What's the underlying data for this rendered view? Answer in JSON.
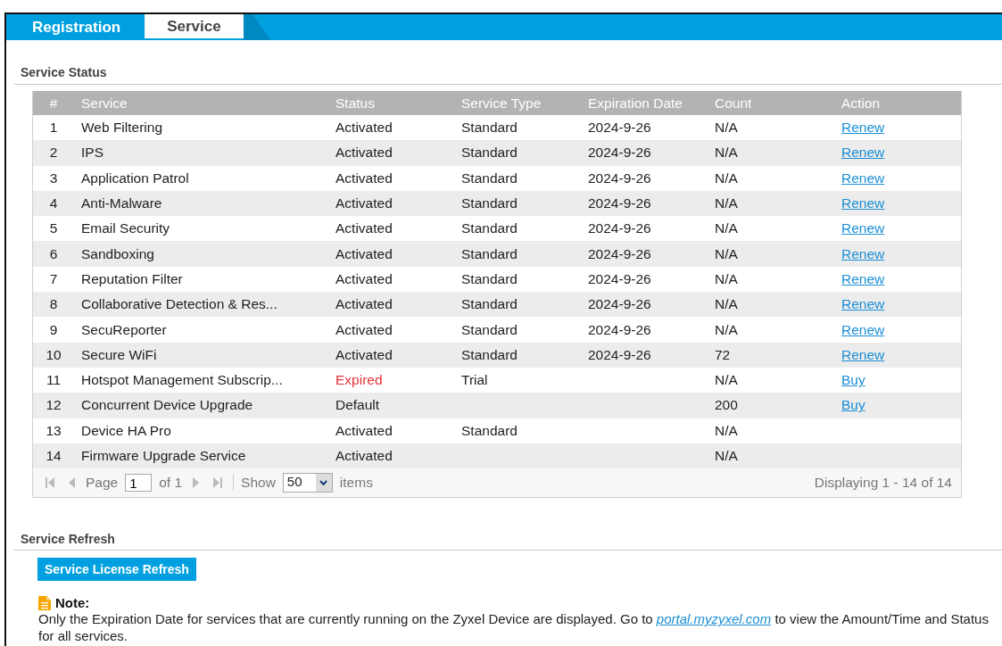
{
  "tabs": [
    {
      "label": "Registration",
      "selected": false
    },
    {
      "label": "Service",
      "selected": true
    }
  ],
  "service_status": {
    "title": "Service Status",
    "table": {
      "columns": [
        "#",
        "Service",
        "Status",
        "Service Type",
        "Expiration Date",
        "Count",
        "Action"
      ],
      "rows": [
        {
          "index": "1",
          "service": "Web Filtering",
          "status": "Activated",
          "expired": false,
          "type": "Standard",
          "expiration": "2024-9-26",
          "count": "N/A",
          "action": "Renew"
        },
        {
          "index": "2",
          "service": "IPS",
          "status": "Activated",
          "expired": false,
          "type": "Standard",
          "expiration": "2024-9-26",
          "count": "N/A",
          "action": "Renew"
        },
        {
          "index": "3",
          "service": "Application Patrol",
          "status": "Activated",
          "expired": false,
          "type": "Standard",
          "expiration": "2024-9-26",
          "count": "N/A",
          "action": "Renew"
        },
        {
          "index": "4",
          "service": "Anti-Malware",
          "status": "Activated",
          "expired": false,
          "type": "Standard",
          "expiration": "2024-9-26",
          "count": "N/A",
          "action": "Renew"
        },
        {
          "index": "5",
          "service": "Email Security",
          "status": "Activated",
          "expired": false,
          "type": "Standard",
          "expiration": "2024-9-26",
          "count": "N/A",
          "action": "Renew"
        },
        {
          "index": "6",
          "service": "Sandboxing",
          "status": "Activated",
          "expired": false,
          "type": "Standard",
          "expiration": "2024-9-26",
          "count": "N/A",
          "action": "Renew"
        },
        {
          "index": "7",
          "service": "Reputation Filter",
          "status": "Activated",
          "expired": false,
          "type": "Standard",
          "expiration": "2024-9-26",
          "count": "N/A",
          "action": "Renew"
        },
        {
          "index": "8",
          "service": "Collaborative Detection & Res...",
          "status": "Activated",
          "expired": false,
          "type": "Standard",
          "expiration": "2024-9-26",
          "count": "N/A",
          "action": "Renew"
        },
        {
          "index": "9",
          "service": "SecuReporter",
          "status": "Activated",
          "expired": false,
          "type": "Standard",
          "expiration": "2024-9-26",
          "count": "N/A",
          "action": "Renew"
        },
        {
          "index": "10",
          "service": "Secure WiFi",
          "status": "Activated",
          "expired": false,
          "type": "Standard",
          "expiration": "2024-9-26",
          "count": "72",
          "action": "Renew"
        },
        {
          "index": "11",
          "service": "Hotspot Management Subscrip...",
          "status": "Expired",
          "expired": true,
          "type": "Trial",
          "count": "N/A",
          "action": "Buy"
        },
        {
          "index": "12",
          "service": "Concurrent Device Upgrade",
          "status": "Default",
          "expired": false,
          "count": "200",
          "action": "Buy"
        },
        {
          "index": "13",
          "service": "Device HA Pro",
          "status": "Activated",
          "expired": false,
          "type": "Standard",
          "count": "N/A"
        },
        {
          "index": "14",
          "service": "Firmware Upgrade Service",
          "status": "Activated",
          "expired": false,
          "count": "N/A"
        }
      ]
    },
    "pager": {
      "page_label": "Page",
      "page": "1",
      "of": "of 1",
      "show_label": "Show",
      "per_page": "50",
      "items_label": "items",
      "summary": "Displaying 1 - 14 of 14"
    }
  },
  "service_refresh": {
    "title": "Service Refresh",
    "button": "Service License Refresh",
    "note": {
      "title": "Note:",
      "text_before": "Only the Expiration Date for services that are currently running on the Zyxel Device are displayed. Go to ",
      "link": "portal.myzyxel.com",
      "text_after": " to view the Amount/Time and Status for all services."
    }
  }
}
